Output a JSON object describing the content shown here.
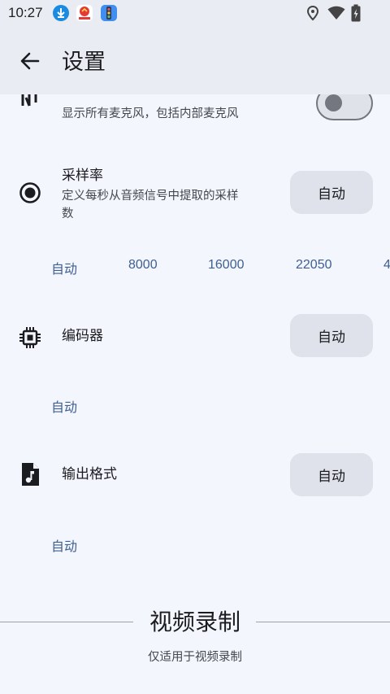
{
  "status_bar": {
    "time": "10:27",
    "notification_icons": [
      "download-icon",
      "app-notification-icon",
      "traffic-light-icon"
    ],
    "system_icons": [
      "location-icon",
      "wifi-icon",
      "battery-charging-icon"
    ]
  },
  "app_bar": {
    "back_icon": "arrow-back-icon",
    "title": "设置"
  },
  "settings": {
    "show_all_mics": {
      "icon": "microphone-icon",
      "subtitle": "显示所有麦克风，包括内部麦克风",
      "toggle_on": false
    },
    "sample_rate": {
      "icon": "radio-button-icon",
      "title": "采样率",
      "subtitle_line1": "定义每秒从音频信号中提取的采样",
      "subtitle_line2": "数",
      "button_label": "自动",
      "options": [
        "自动",
        "8000",
        "16000",
        "22050",
        "4"
      ]
    },
    "encoder": {
      "icon": "chip-icon",
      "title": "编码器",
      "button_label": "自动",
      "options": [
        "自动"
      ]
    },
    "output_format": {
      "icon": "music-file-icon",
      "title": "输出格式",
      "button_label": "自动",
      "options": [
        "自动"
      ]
    }
  },
  "video_section": {
    "title": "视频录制",
    "subtitle": "仅适用于视频录制"
  },
  "colors": {
    "background": "#f3f6fc",
    "app_bar": "#e9ecf2",
    "button": "#dfe2ea",
    "chip_text": "#3e5f90"
  }
}
